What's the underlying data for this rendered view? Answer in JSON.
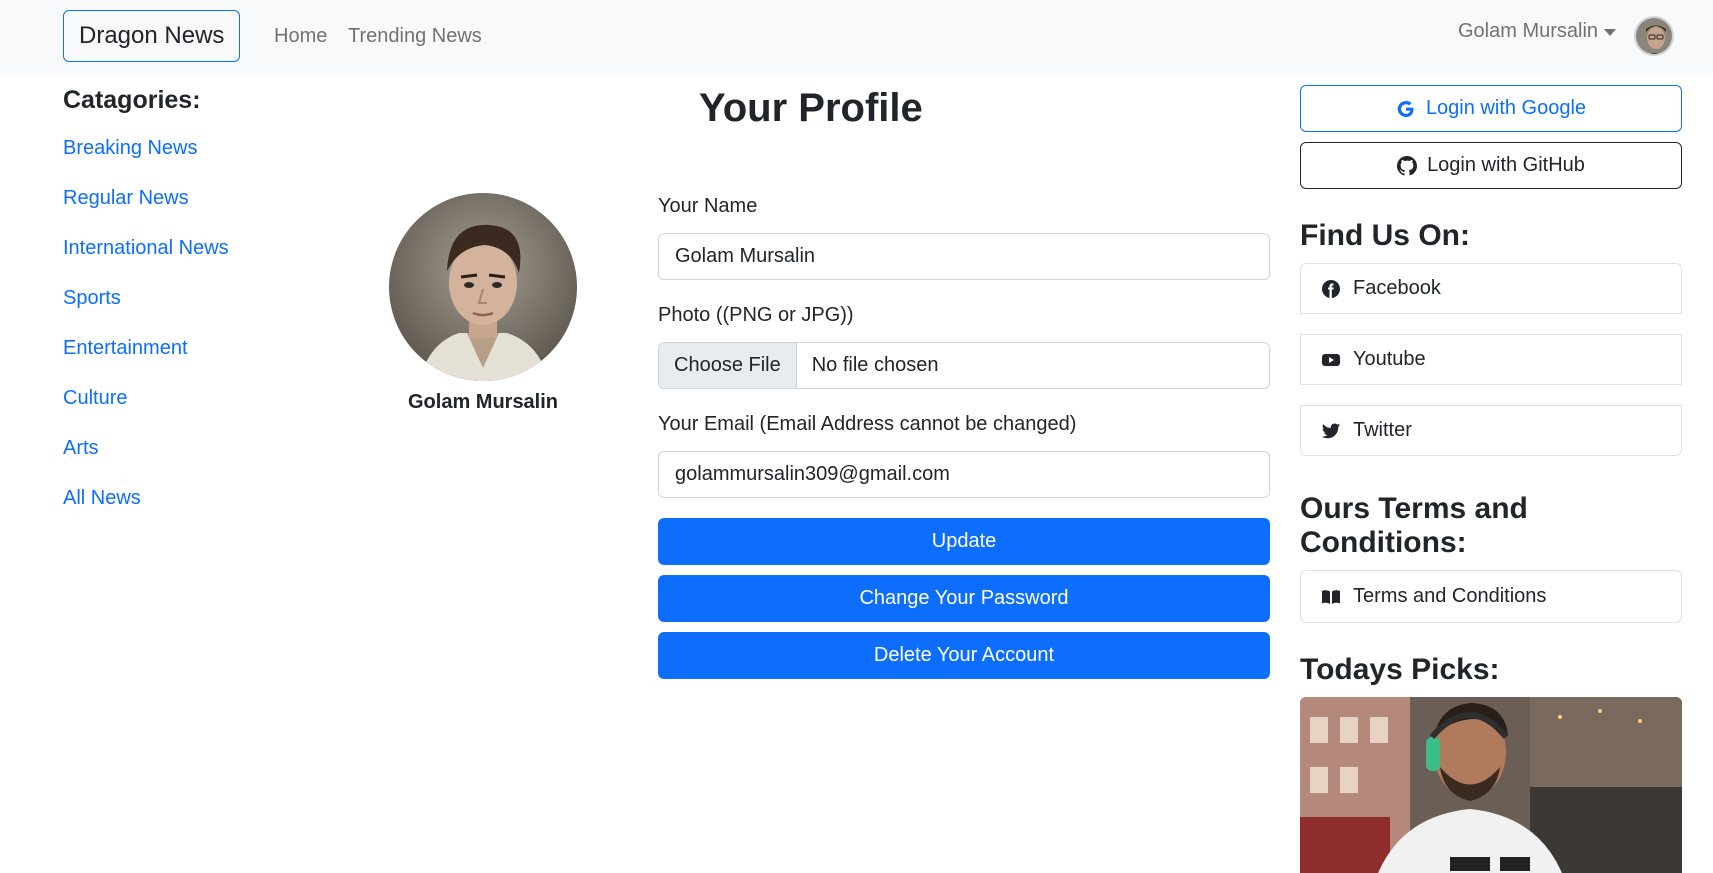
{
  "navbar": {
    "brand": "Dragon News",
    "links": [
      "Home",
      "Trending News"
    ],
    "user_name": "Golam Mursalin"
  },
  "categories": {
    "title": "Catagories:",
    "items": [
      "Breaking News",
      "Regular News",
      "International News",
      "Sports",
      "Entertainment",
      "Culture",
      "Arts",
      "All News"
    ]
  },
  "profile": {
    "title": "Your Profile",
    "name": "Golam Mursalin",
    "form": {
      "name_label": "Your Name",
      "name_value": "Golam Mursalin",
      "photo_label": "Photo ((PNG or JPG))",
      "file_button": "Choose File",
      "file_status": "No file chosen",
      "email_label": "Your Email (Email Address cannot be changed)",
      "email_value": "golammursalin309@gmail.com",
      "update": "Update",
      "change_password": "Change Your Password",
      "delete_account": "Delete Your Account"
    }
  },
  "sidebar": {
    "login_google": "Login with Google",
    "login_github": "Login with GitHub",
    "find_us_title": "Find Us On:",
    "social": [
      "Facebook",
      "Youtube",
      "Twitter"
    ],
    "terms_title": "Ours Terms and Conditions:",
    "terms_item": "Terms and Conditions",
    "picks_title": "Todays Picks:"
  },
  "colors": {
    "primary": "#0d6efd",
    "navbar_bg": "#f8f9fa",
    "text": "#212529"
  }
}
